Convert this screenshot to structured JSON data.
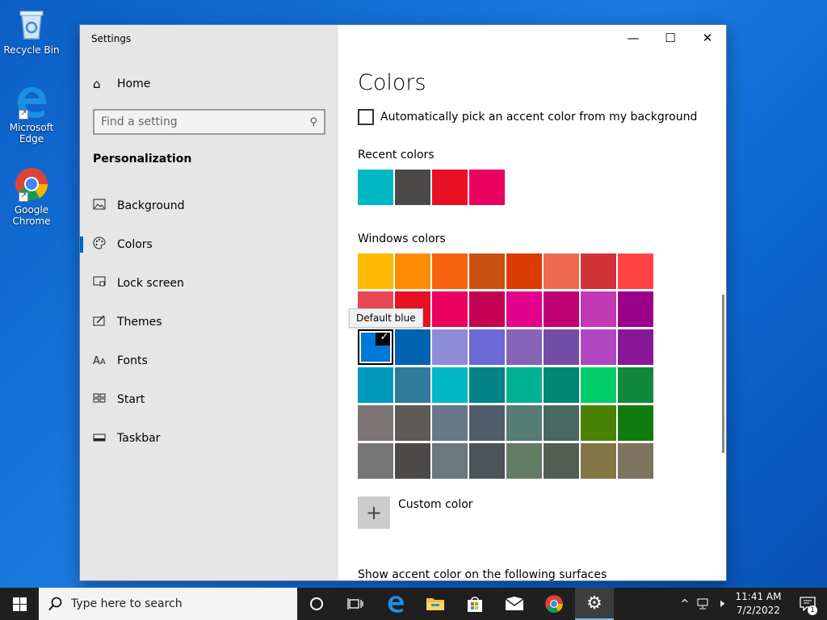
{
  "desktop": {
    "icons": [
      {
        "label": "Recycle Bin"
      },
      {
        "label": "Microsoft Edge"
      },
      {
        "label": "Google Chrome"
      }
    ]
  },
  "window": {
    "title": "Settings",
    "controls": {
      "minimize": "—",
      "maximize": "☐",
      "close": "✕"
    }
  },
  "sidebar": {
    "home": "Home",
    "search_placeholder": "Find a setting",
    "section": "Personalization",
    "items": [
      {
        "label": "Background",
        "icon": "image-icon"
      },
      {
        "label": "Colors",
        "icon": "palette-icon"
      },
      {
        "label": "Lock screen",
        "icon": "lock-screen-icon"
      },
      {
        "label": "Themes",
        "icon": "themes-icon"
      },
      {
        "label": "Fonts",
        "icon": "fonts-icon"
      },
      {
        "label": "Start",
        "icon": "start-icon"
      },
      {
        "label": "Taskbar",
        "icon": "taskbar-icon"
      }
    ],
    "active_index": 1
  },
  "main": {
    "title": "Colors",
    "auto_accent_label": "Automatically pick an accent color from my background",
    "auto_accent_checked": false,
    "recent_label": "Recent colors",
    "recent_colors": [
      "#00b7c3",
      "#4c4a48",
      "#e81123",
      "#ea005e"
    ],
    "windows_label": "Windows colors",
    "windows_colors": [
      [
        "#ffb900",
        "#ff8c00",
        "#f7630c",
        "#ca5010",
        "#da3b01",
        "#ef6950",
        "#d13438",
        "#ff4343"
      ],
      [
        "#e74856",
        "#e81123",
        "#ea005e",
        "#c30052",
        "#e3008c",
        "#bf0077",
        "#c239b3",
        "#9a0089"
      ],
      [
        "#0078d7",
        "#0063b1",
        "#8e8cd8",
        "#6b69d6",
        "#8764b8",
        "#744da9",
        "#b146c2",
        "#881798"
      ],
      [
        "#0099bc",
        "#2d7d9a",
        "#00b7c3",
        "#038387",
        "#00b294",
        "#018574",
        "#00cc6a",
        "#10893e"
      ],
      [
        "#7a7574",
        "#5d5a58",
        "#68768a",
        "#515c6b",
        "#567c73",
        "#486860",
        "#498205",
        "#107c10"
      ],
      [
        "#767676",
        "#4c4a48",
        "#69797e",
        "#4a5459",
        "#647c64",
        "#525e54",
        "#847545",
        "#7e735f"
      ]
    ],
    "selected_color": {
      "row": 2,
      "col": 0
    },
    "checkmark": "✓",
    "tooltip": "Default blue",
    "custom_color_label": "Custom color",
    "custom_icon": "+",
    "surfaces_label": "Show accent color on the following surfaces"
  },
  "taskbar": {
    "search_placeholder": "Type here to search",
    "time": "11:41 AM",
    "date": "7/2/2022",
    "notification_count": "1"
  }
}
